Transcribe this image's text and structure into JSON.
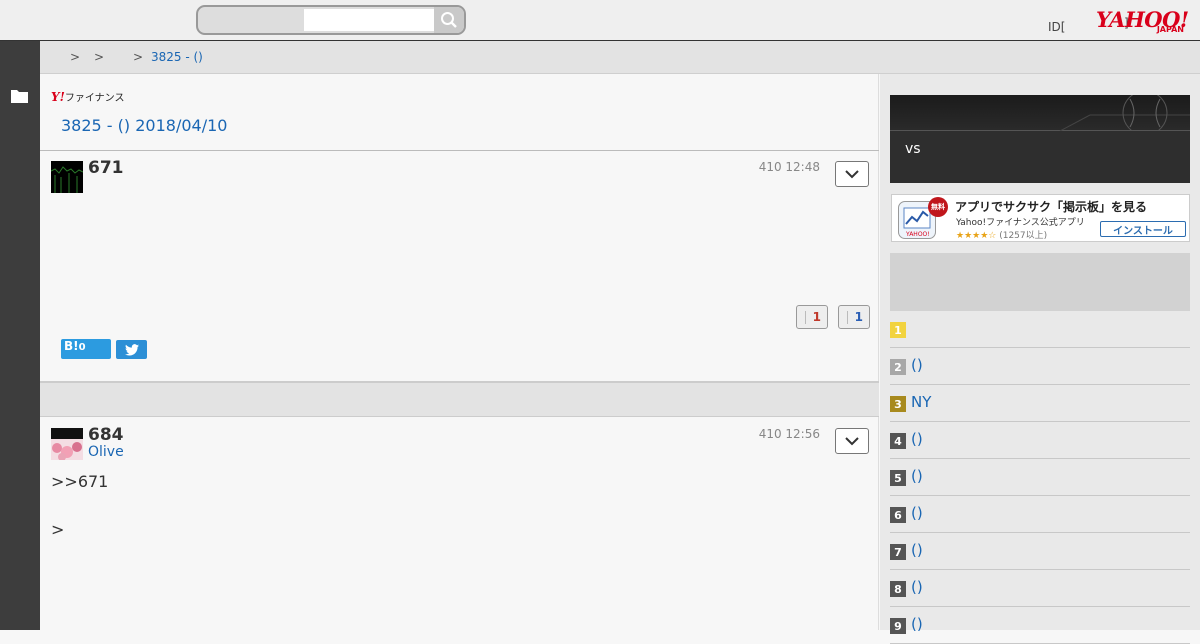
{
  "header": {
    "search": {
      "placeholder": "",
      "value": ""
    },
    "id_text": "ID[",
    "id_bracket": "]",
    "logo_text": "YAHOO!",
    "logo_sub": "JAPAN"
  },
  "breadcrumb": {
    "sep1": ">",
    "sep2": ">",
    "sep3": ">",
    "current": "3825 - ()"
  },
  "main": {
    "brand": "Y!",
    "brand_text": "ファイナンス",
    "page_title": "3825 - () 2018/04/10",
    "posts": [
      {
        "number": "671",
        "time": "410 12:48",
        "likes": "1",
        "dislikes": "1"
      },
      {
        "number": "684",
        "time": "410 12:56",
        "author": "Olive",
        "reply_ref": ">>671",
        "body": ">"
      }
    ],
    "hatena": {
      "label": "B!",
      "count": "0"
    }
  },
  "sidebar": {
    "banner_text": "vs",
    "app_ad": {
      "badge": "無料",
      "title": "アプリでサクサク「掲示板」を見る",
      "subtitle": "Yahoo!ファイナンス公式アプリ",
      "stars": "★★★★☆",
      "reviews": "(1257以上)",
      "install": "インストール"
    },
    "ranking": [
      {
        "rank": "1",
        "label": "",
        "color": "#f2d33f"
      },
      {
        "rank": "2",
        "label": "()",
        "color": "#a8a8a8"
      },
      {
        "rank": "3",
        "label": "NY",
        "color": "#a88a1e"
      },
      {
        "rank": "4",
        "label": "()",
        "color": "#555555"
      },
      {
        "rank": "5",
        "label": "()",
        "color": "#555555"
      },
      {
        "rank": "6",
        "label": "()",
        "color": "#555555"
      },
      {
        "rank": "7",
        "label": "()",
        "color": "#555555"
      },
      {
        "rank": "8",
        "label": "()",
        "color": "#555555"
      },
      {
        "rank": "9",
        "label": "()",
        "color": "#555555"
      }
    ]
  },
  "colors": {
    "link": "#1a66b3",
    "brand_red": "#d9001b",
    "rail": "#3d3d3d"
  }
}
